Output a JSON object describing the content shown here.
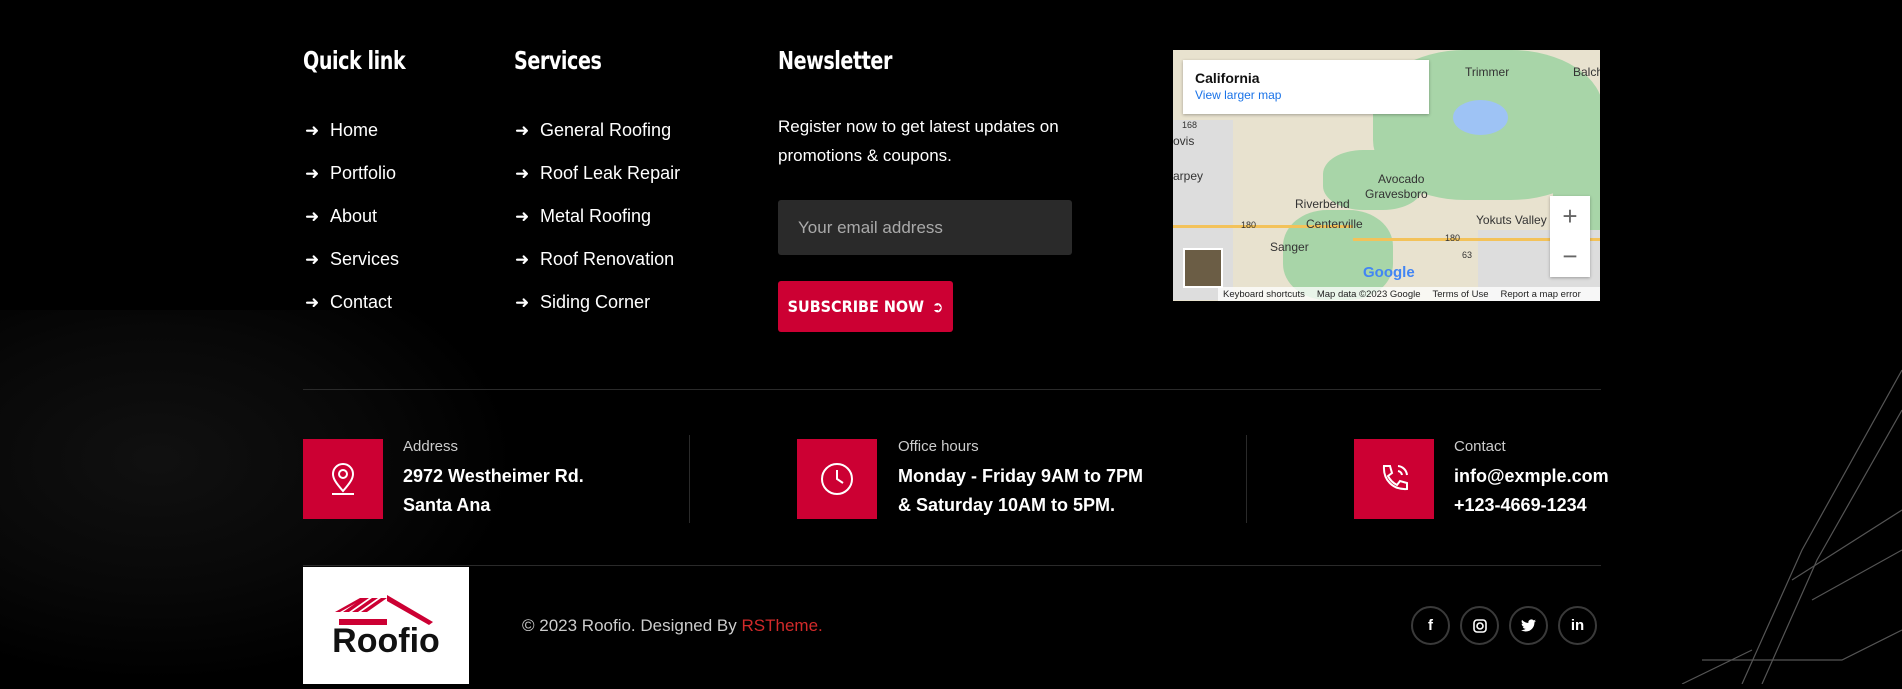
{
  "quick_links": {
    "title": "Quick link",
    "items": [
      "Home",
      "Portfolio",
      "About",
      "Services",
      "Contact"
    ]
  },
  "services": {
    "title": "Services",
    "items": [
      "General Roofing",
      "Roof Leak Repair",
      "Metal Roofing",
      "Roof Renovation",
      "Siding Corner"
    ]
  },
  "newsletter": {
    "title": "Newsletter",
    "text": "Register now to get latest updates on promotions & coupons.",
    "email_placeholder": "Your email address",
    "email_value": "",
    "button": "SUBSCRIBE NOW"
  },
  "map": {
    "place": "California",
    "link": "View larger map",
    "labels": [
      "Trimmer",
      "Balch",
      "Avocado",
      "Gravesboro",
      "Riverbend",
      "Centerville",
      "Sanger",
      "Yokuts Valley",
      "ovis",
      "arpey",
      "168",
      "180",
      "180",
      "63"
    ],
    "attribution": [
      "Keyboard shortcuts",
      "Map data ©2023 Google",
      "Terms of Use",
      "Report a map error"
    ],
    "google": "Google"
  },
  "info": [
    {
      "label": "Address",
      "lines": [
        "2972 Westheimer Rd.",
        "Santa Ana"
      ],
      "icon": "map-pin-icon"
    },
    {
      "label": "Office hours",
      "lines": [
        "Monday - Friday 9AM to 7PM",
        "& Saturday 10AM to 5PM."
      ],
      "icon": "clock-icon"
    },
    {
      "label": "Contact",
      "lines": [
        "info@exmple.com",
        "+123-4669-1234"
      ],
      "icon": "phone-icon"
    }
  ],
  "footer": {
    "logo": "Roofio",
    "copyright": "© 2023 Roofio. Designed By",
    "designer": "RSTheme."
  },
  "social": [
    "facebook-icon",
    "instagram-icon",
    "twitter-icon",
    "linkedin-icon"
  ],
  "colors": {
    "accent": "#cc0033",
    "background": "#000000"
  }
}
